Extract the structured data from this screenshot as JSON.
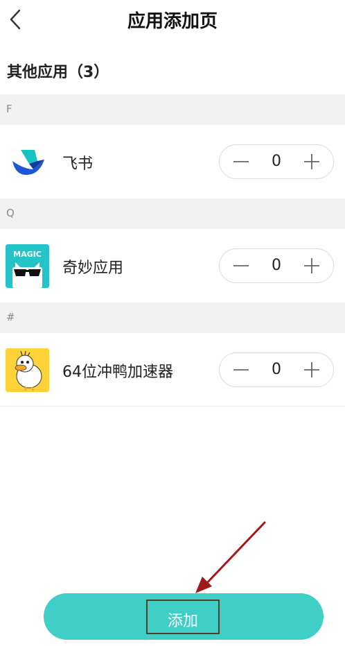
{
  "header": {
    "title": "应用添加页"
  },
  "section": {
    "title": "其他应用（3）"
  },
  "groups": [
    {
      "letter": "F",
      "app": {
        "name": "飞书",
        "count": "0",
        "icon": "feishu-logo"
      }
    },
    {
      "letter": "Q",
      "app": {
        "name": "奇妙应用",
        "count": "0",
        "icon": "magic-app-logo",
        "icon_text": "MAGIC"
      }
    },
    {
      "letter": "#",
      "app": {
        "name": "64位冲鸭加速器",
        "count": "0",
        "icon": "duck-accelerator-logo"
      }
    }
  ],
  "footer": {
    "add_label": "添加"
  },
  "colors": {
    "accent": "#3fcfc7",
    "group_bg": "#f2f2f2",
    "annotation_arrow": "#a01818"
  }
}
